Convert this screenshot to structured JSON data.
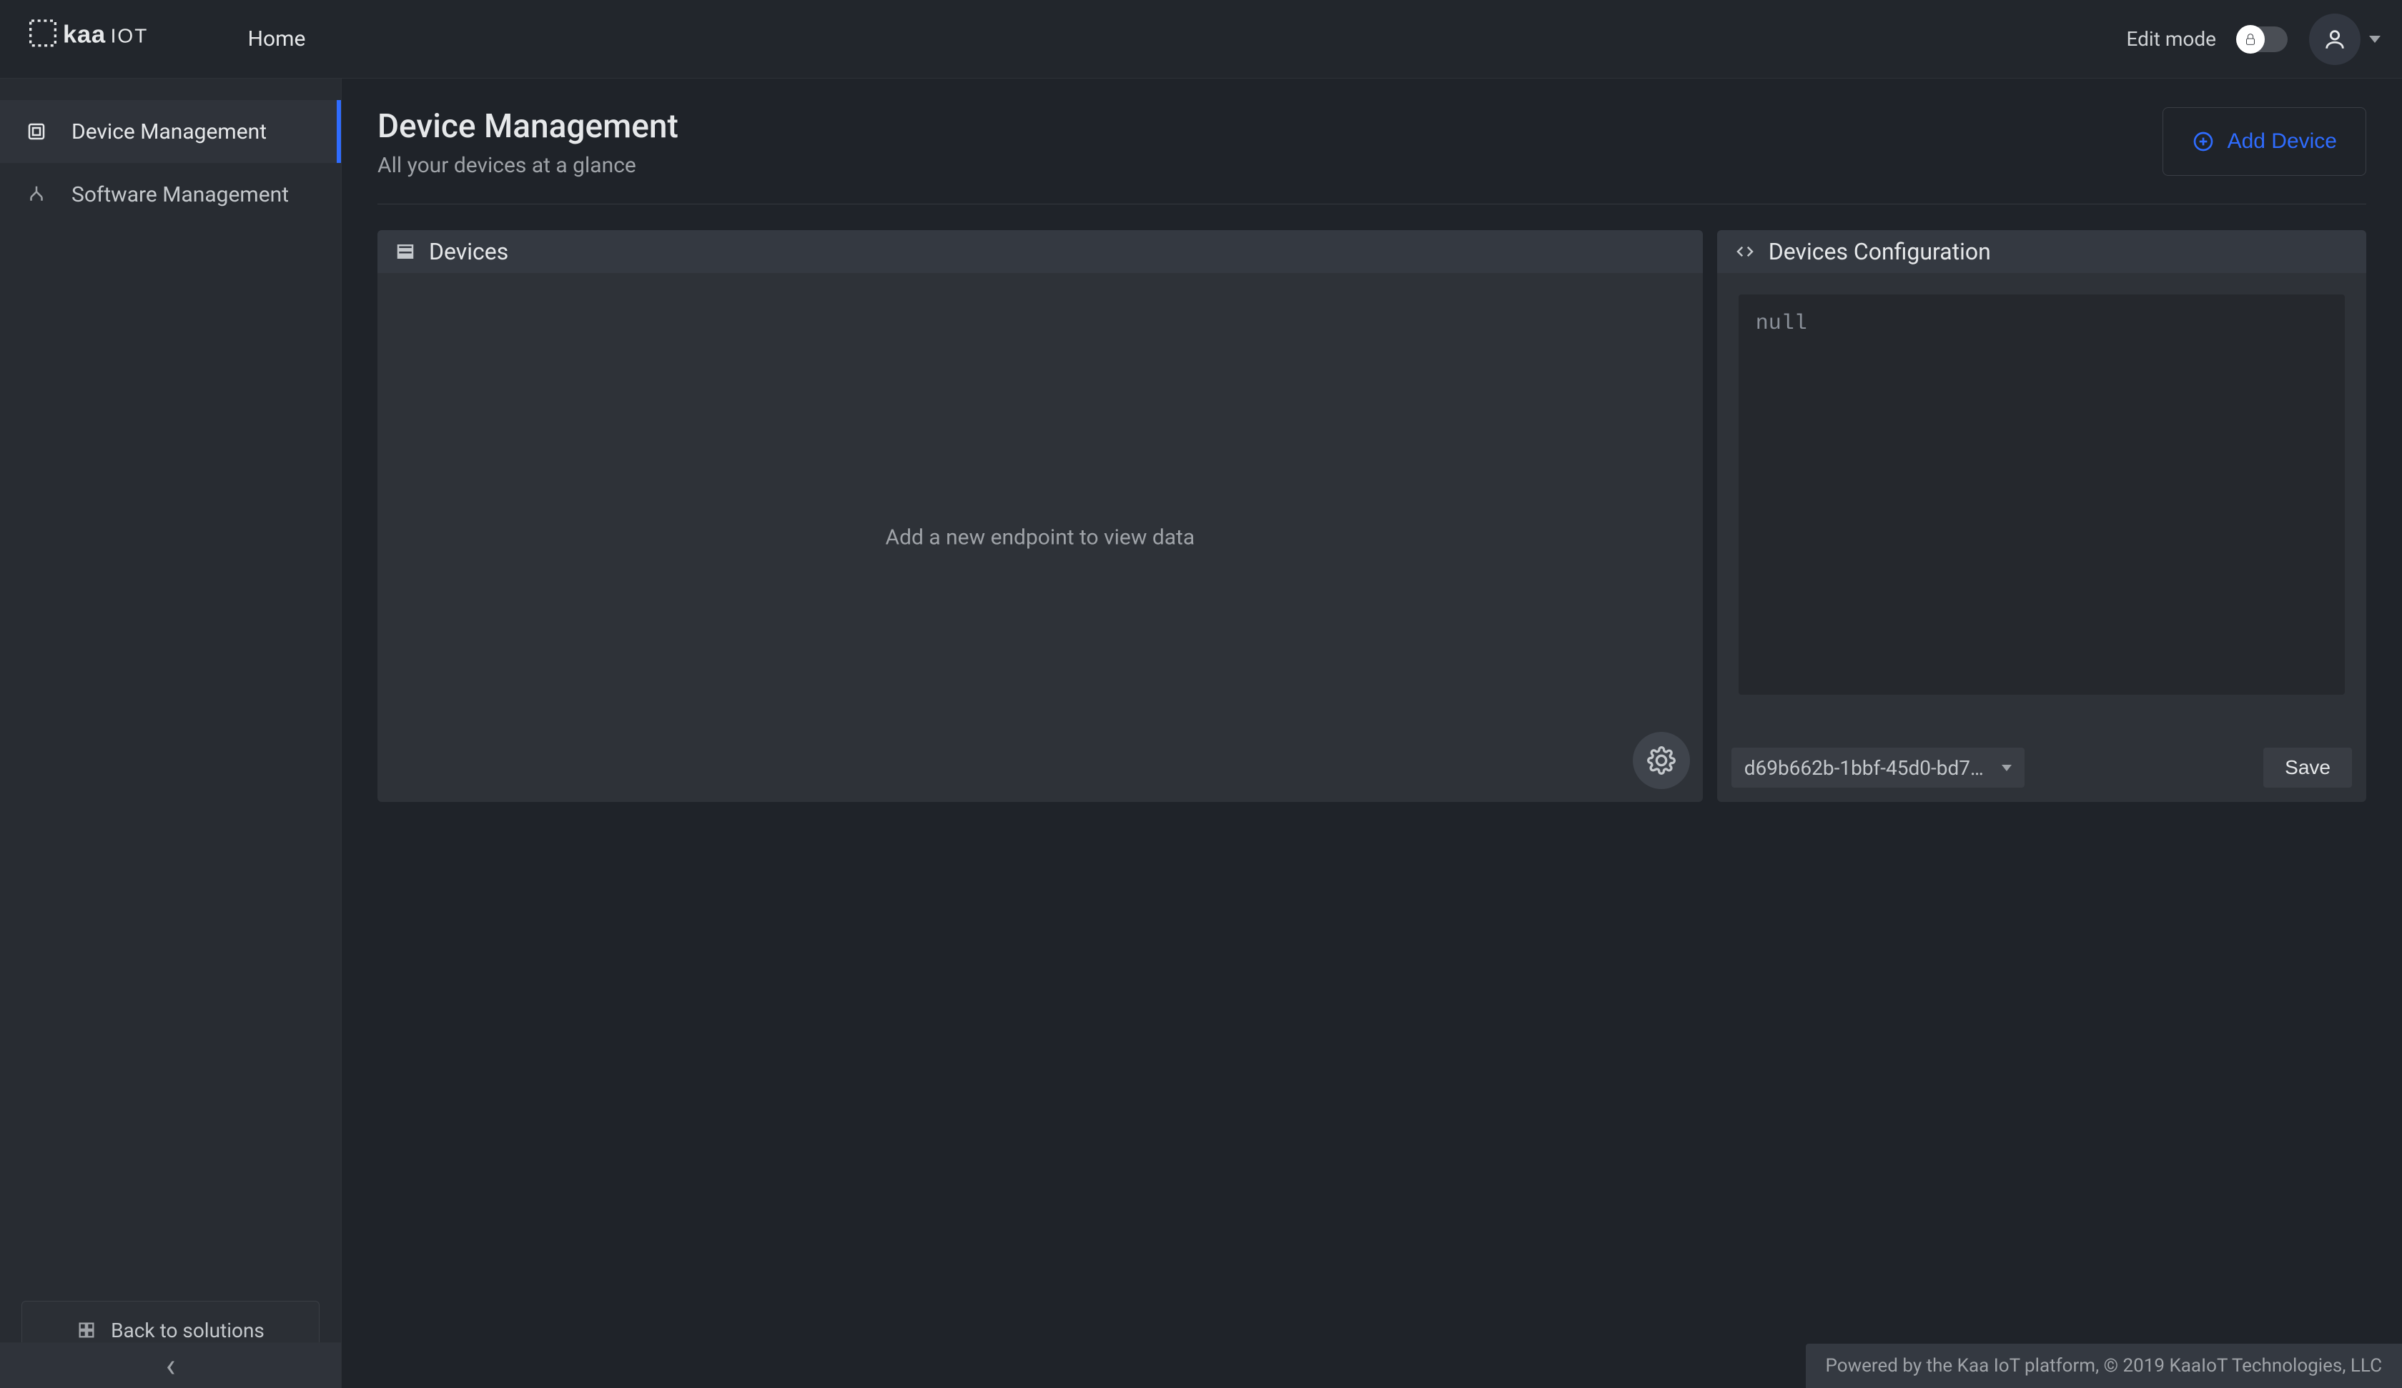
{
  "topbar": {
    "home_label": "Home",
    "edit_mode_label": "Edit mode"
  },
  "sidebar": {
    "items": [
      {
        "label": "Device Management",
        "active": true
      },
      {
        "label": "Software Management",
        "active": false
      }
    ],
    "back_label": "Back to solutions",
    "collapse_glyph": "‹"
  },
  "page": {
    "title": "Device Management",
    "subtitle": "All your devices at a glance",
    "add_device_label": "Add Device"
  },
  "devices_card": {
    "title": "Devices",
    "empty_text": "Add a new endpoint to view data"
  },
  "config_card": {
    "title": "Devices Configuration",
    "code_content": "null",
    "selected_device": "d69b662b-1bbf-45d0-bd70…",
    "save_label": "Save"
  },
  "footer": {
    "text": "Powered by the Kaa IoT platform, © 2019 KaaIoT Technologies, LLC"
  }
}
